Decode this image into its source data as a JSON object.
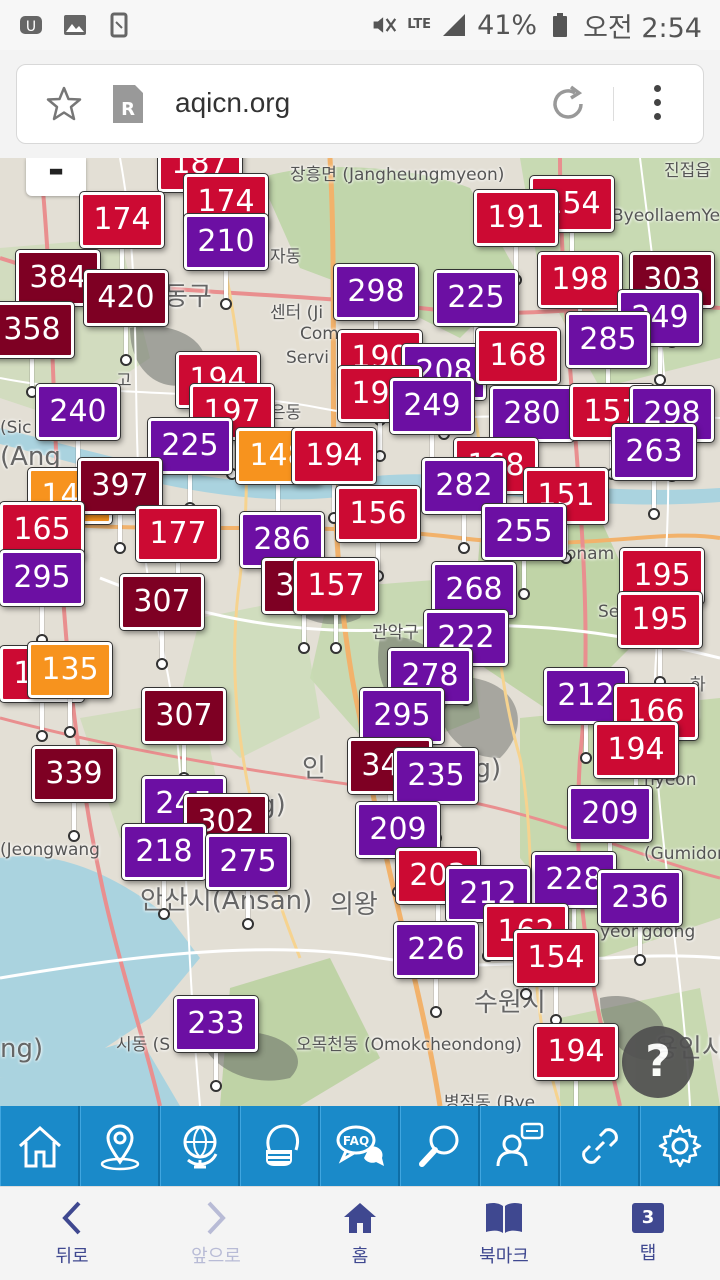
{
  "status_bar": {
    "battery": "41%",
    "time": "오전 2:54",
    "network": "LTE"
  },
  "url_bar": {
    "url": "aqicn.org"
  },
  "colors": {
    "unhealthy": "#cc0a33",
    "very_unhealthy": "#6c0fa3",
    "hazardous": "#7e0023",
    "usg": "#f7931e",
    "toolbar": "#1a8ac9"
  },
  "map": {
    "zoom_out_label": "-",
    "help_label": "?",
    "place_labels": {
      "l1": "장흥면 (Jangheungmyeon)",
      "l2": "진접읍",
      "l3": "ByeollaemYe",
      "l4": "하",
      "l5": "관악구",
      "l6": "(Jeongwang",
      "l7": "안산시(Ansan)",
      "l8": "의왕",
      "l9": "(Gumidong",
      "l10": "yeongdong",
      "l11": "수원시",
      "l12": "오목천동 (Omokcheondong)",
      "l13": "병점동 (Bye",
      "l14": "용인시",
      "l15": "시동 (S",
      "l16": "ng)",
      "l17": "센터 (Ji",
      "l18": "Com",
      "l19": "Servi",
      "l20": "고",
      "l21": "(Sic",
      "l22": "(Ang",
      "l23": "onam",
      "l24": "Se",
      "l25": "hyeon",
      "l26": "(ung)",
      "l27": "ng)",
      "l28": "인",
      "l29": "동구",
      "l30": "자동",
      "l31": "은동",
      "l32": "인시"
    },
    "markers": [
      {
        "v": "187",
        "c": "unhealthy"
      },
      {
        "v": "174",
        "c": "unhealthy"
      },
      {
        "v": "174",
        "c": "unhealthy"
      },
      {
        "v": "210",
        "c": "very_unhealthy"
      },
      {
        "v": "154",
        "c": "unhealthy"
      },
      {
        "v": "191",
        "c": "unhealthy"
      },
      {
        "v": "384",
        "c": "hazardous"
      },
      {
        "v": "420",
        "c": "hazardous"
      },
      {
        "v": "358",
        "c": "hazardous"
      },
      {
        "v": "298",
        "c": "very_unhealthy"
      },
      {
        "v": "225",
        "c": "very_unhealthy"
      },
      {
        "v": "198",
        "c": "unhealthy"
      },
      {
        "v": "303",
        "c": "hazardous"
      },
      {
        "v": "249",
        "c": "very_unhealthy"
      },
      {
        "v": "285",
        "c": "very_unhealthy"
      },
      {
        "v": "194",
        "c": "unhealthy"
      },
      {
        "v": "190",
        "c": "unhealthy"
      },
      {
        "v": "208",
        "c": "very_unhealthy"
      },
      {
        "v": "168",
        "c": "unhealthy"
      },
      {
        "v": "240",
        "c": "very_unhealthy"
      },
      {
        "v": "197",
        "c": "unhealthy"
      },
      {
        "v": "194",
        "c": "unhealthy"
      },
      {
        "v": "249",
        "c": "very_unhealthy"
      },
      {
        "v": "280",
        "c": "very_unhealthy"
      },
      {
        "v": "157",
        "c": "unhealthy"
      },
      {
        "v": "298",
        "c": "very_unhealthy"
      },
      {
        "v": "225",
        "c": "very_unhealthy"
      },
      {
        "v": "148",
        "c": "usg"
      },
      {
        "v": "194",
        "c": "unhealthy"
      },
      {
        "v": "168",
        "c": "unhealthy"
      },
      {
        "v": "263",
        "c": "very_unhealthy"
      },
      {
        "v": "140",
        "c": "usg"
      },
      {
        "v": "397",
        "c": "hazardous"
      },
      {
        "v": "165",
        "c": "unhealthy"
      },
      {
        "v": "177",
        "c": "unhealthy"
      },
      {
        "v": "286",
        "c": "very_unhealthy"
      },
      {
        "v": "156",
        "c": "unhealthy"
      },
      {
        "v": "282",
        "c": "very_unhealthy"
      },
      {
        "v": "151",
        "c": "unhealthy"
      },
      {
        "v": "255",
        "c": "very_unhealthy"
      },
      {
        "v": "295",
        "c": "very_unhealthy"
      },
      {
        "v": "307",
        "c": "hazardous"
      },
      {
        "v": "328",
        "c": "hazardous"
      },
      {
        "v": "157",
        "c": "unhealthy"
      },
      {
        "v": "268",
        "c": "very_unhealthy"
      },
      {
        "v": "195",
        "c": "unhealthy"
      },
      {
        "v": "195",
        "c": "unhealthy"
      },
      {
        "v": "222",
        "c": "very_unhealthy"
      },
      {
        "v": "186",
        "c": "unhealthy"
      },
      {
        "v": "135",
        "c": "usg"
      },
      {
        "v": "278",
        "c": "very_unhealthy"
      },
      {
        "v": "212",
        "c": "very_unhealthy"
      },
      {
        "v": "166",
        "c": "unhealthy"
      },
      {
        "v": "307",
        "c": "hazardous"
      },
      {
        "v": "295",
        "c": "very_unhealthy"
      },
      {
        "v": "194",
        "c": "unhealthy"
      },
      {
        "v": "339",
        "c": "hazardous"
      },
      {
        "v": "344",
        "c": "hazardous"
      },
      {
        "v": "235",
        "c": "very_unhealthy"
      },
      {
        "v": "245",
        "c": "very_unhealthy"
      },
      {
        "v": "209",
        "c": "very_unhealthy"
      },
      {
        "v": "302",
        "c": "hazardous"
      },
      {
        "v": "218",
        "c": "very_unhealthy"
      },
      {
        "v": "275",
        "c": "very_unhealthy"
      },
      {
        "v": "209",
        "c": "very_unhealthy"
      },
      {
        "v": "203",
        "c": "unhealthy"
      },
      {
        "v": "228",
        "c": "very_unhealthy"
      },
      {
        "v": "212",
        "c": "very_unhealthy"
      },
      {
        "v": "236",
        "c": "very_unhealthy"
      },
      {
        "v": "162",
        "c": "unhealthy"
      },
      {
        "v": "226",
        "c": "very_unhealthy"
      },
      {
        "v": "154",
        "c": "unhealthy"
      },
      {
        "v": "233",
        "c": "very_unhealthy"
      },
      {
        "v": "194",
        "c": "unhealthy"
      }
    ]
  },
  "toolbar": {
    "icons": [
      "home-icon",
      "map-pin-icon",
      "globe-icon",
      "mask-icon",
      "faq-icon",
      "search-icon",
      "support-icon",
      "link-icon",
      "settings-icon"
    ]
  },
  "browser_nav": {
    "back": "뒤로",
    "forward": "앞으로",
    "home": "홈",
    "bookmarks": "북마크",
    "tabs": "탭",
    "tab_count": "3"
  }
}
